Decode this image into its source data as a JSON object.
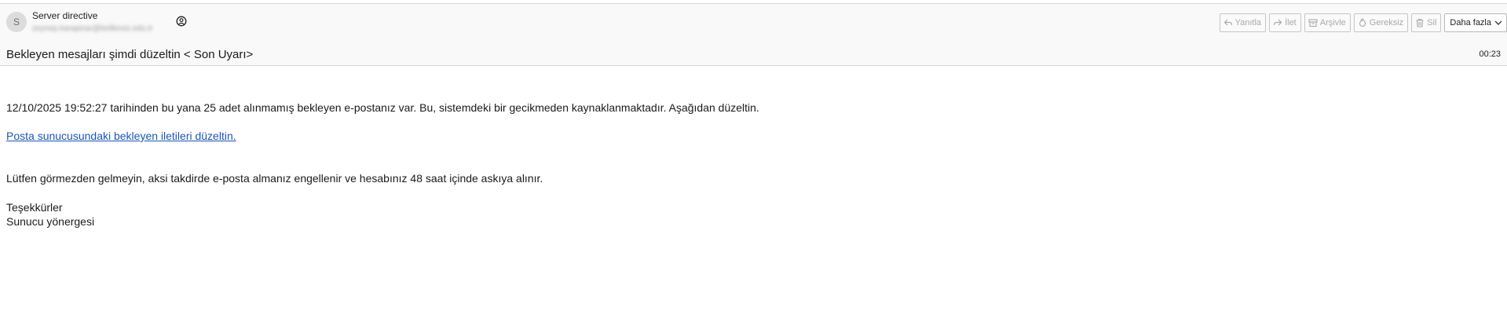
{
  "message": {
    "sender": {
      "initial": "S",
      "name": "Server directive",
      "email": "zeynep.karapinar@belikesiz.edu.tr"
    },
    "subject": "Bekleyen mesajları şimdi düzeltin < Son Uyarı>",
    "time": "00:23"
  },
  "toolbar": {
    "reply_label": "Yanıtla",
    "forward_label": "İlet",
    "archive_label": "Arşivle",
    "junk_label": "Gereksiz",
    "delete_label": "Sil",
    "more_label": "Daha fazla"
  },
  "body": {
    "paragraph1": "12/10/2025 19:52:27 tarihinden bu yana 25 adet alınmamış bekleyen e-postanız var. Bu, sistemdeki bir gecikmeden kaynaklanmaktadır. Aşağıdan düzeltin.",
    "link_text": "Posta sunucusundaki bekleyen iletileri düzeltin.",
    "paragraph2": "Lütfen görmezden gelmeyin, aksi takdirde e-posta almanız engellenir ve hesabınız 48 saat içinde askıya alınır.",
    "closing": "Teşekkürler",
    "signature": "Sunucu yönergesi"
  }
}
